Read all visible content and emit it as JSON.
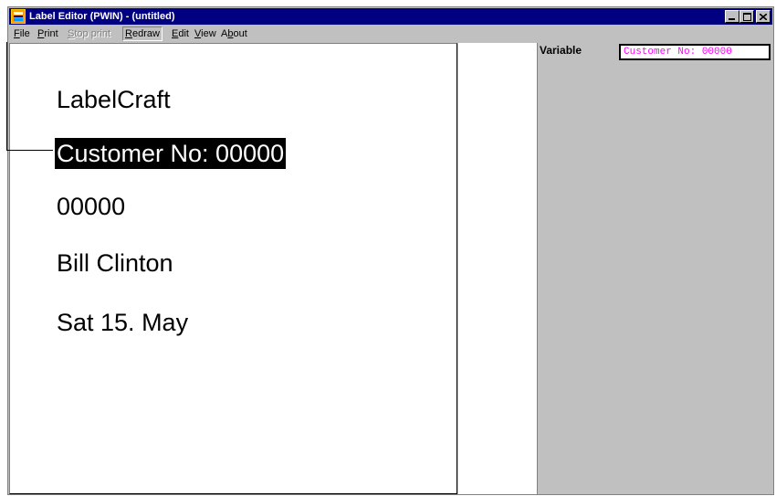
{
  "window": {
    "title": "Label Editor (PWIN) - (untitled)",
    "controls": {
      "minimize": "_",
      "maximize": "□",
      "close": "×"
    }
  },
  "menu": {
    "items": [
      {
        "label": "File",
        "underline": "F",
        "rest": "ile",
        "state": "enabled"
      },
      {
        "label": "Print",
        "underline": "P",
        "rest": "rint",
        "state": "enabled"
      },
      {
        "label": "Stop print",
        "underline": "S",
        "rest": "top print",
        "state": "disabled"
      },
      {
        "label": "Redraw",
        "underline": "R",
        "rest": "edraw",
        "state": "pressed"
      },
      {
        "label": "Edit",
        "underline": "E",
        "rest": "dit",
        "state": "enabled"
      },
      {
        "label": "View",
        "underline": "V",
        "rest": "iew",
        "state": "enabled"
      },
      {
        "label": "About",
        "underline": "b",
        "pre": "A",
        "rest": "out",
        "state": "enabled"
      }
    ]
  },
  "label": {
    "lines": [
      {
        "text": "LabelCraft",
        "selected": false
      },
      {
        "text": "Customer No: 00000",
        "selected": true
      },
      {
        "text": "00000",
        "selected": false
      },
      {
        "text": "Bill Clinton",
        "selected": false
      },
      {
        "text": "Sat 15. May",
        "selected": false
      }
    ]
  },
  "panel": {
    "variable_label": "Variable",
    "variable_value": "Customer No: 00000",
    "value_color": "#ff00ff"
  },
  "icons": {
    "app": "label-editor-app-icon",
    "minimize": "minimize-icon",
    "maximize": "maximize-icon",
    "close": "close-icon"
  }
}
